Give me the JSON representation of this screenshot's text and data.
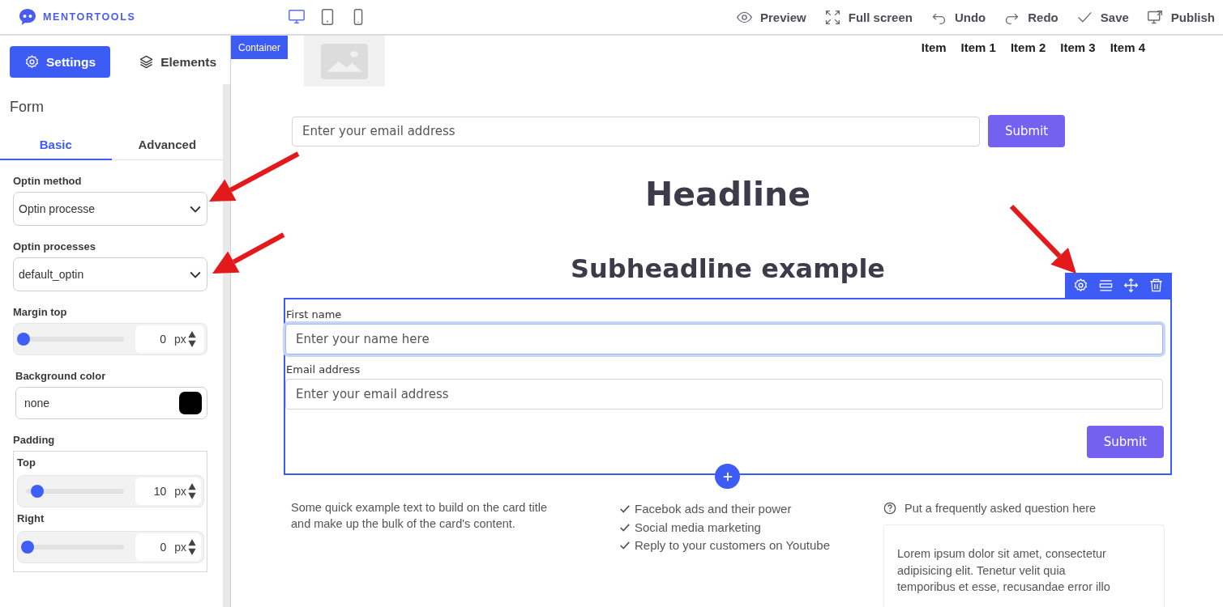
{
  "topbar": {
    "logo": "MENTORTOOLS",
    "devices": [
      {
        "kind": "desktop",
        "selected": true
      },
      {
        "kind": "tablet",
        "selected": false
      },
      {
        "kind": "mobile",
        "selected": false
      }
    ],
    "actions": [
      {
        "kind": "preview",
        "label": "Preview"
      },
      {
        "kind": "fullscreen",
        "label": "Full screen"
      },
      {
        "kind": "undo",
        "label": "Undo"
      },
      {
        "kind": "redo",
        "label": "Redo"
      },
      {
        "kind": "save",
        "label": "Save"
      },
      {
        "kind": "publish",
        "label": "Publish"
      }
    ]
  },
  "sidebar": {
    "tabs": [
      {
        "kind": "settings",
        "label": "Settings",
        "selected": true
      },
      {
        "kind": "elements",
        "label": "Elements",
        "selected": false
      }
    ],
    "section_title": "Form",
    "subtabs": [
      {
        "label": "Basic",
        "selected": true
      },
      {
        "label": "Advanced",
        "selected": false
      }
    ],
    "fields": [
      {
        "kind": "select",
        "label": "Optin method",
        "value": "Optin processe"
      },
      {
        "kind": "select",
        "label": "Optin processes",
        "value": "default_optin"
      },
      {
        "kind": "slider",
        "label": "Margin top",
        "value": "0",
        "unit": "px",
        "level": 0
      },
      {
        "kind": "color",
        "label": "Background color",
        "value": "none",
        "color": "#000000"
      },
      {
        "kind": "group",
        "label": "Padding",
        "children": [
          {
            "kind": "slider",
            "label": "Top",
            "value": "10",
            "unit": "px",
            "level": 0.1
          },
          {
            "kind": "slider",
            "label": "Right",
            "value": "0",
            "unit": "px",
            "level": 0
          }
        ]
      }
    ]
  },
  "canvas": {
    "container_badge": "Container",
    "nav": [
      "Item",
      "Item 1",
      "Item 2",
      "Item 3",
      "Item 4"
    ],
    "optin_bar": {
      "placeholder": "Enter your email address",
      "button": "Submit"
    },
    "headline": "Headline",
    "subheadline": "Subheadline example",
    "form": {
      "selected": true,
      "fields": [
        {
          "label": "First name",
          "placeholder": "Enter your name here",
          "focused": true
        },
        {
          "label": "Email address",
          "placeholder": "Enter your email address",
          "focused": false
        }
      ],
      "button": "Submit"
    },
    "columns": {
      "text": "Some quick example text to build on the card title and make up the bulk of the card's content.",
      "checklist": [
        "Facebok ads and their power",
        "Social media marketing",
        "Reply to your customers on Youtube"
      ],
      "faq": {
        "question": "Put a frequently asked question here",
        "answer": "Lorem ipsum dolor sit amet, consectetur adipisicing elit. Tenetur velit quia temporibus et esse, recusandae error illo"
      }
    }
  }
}
